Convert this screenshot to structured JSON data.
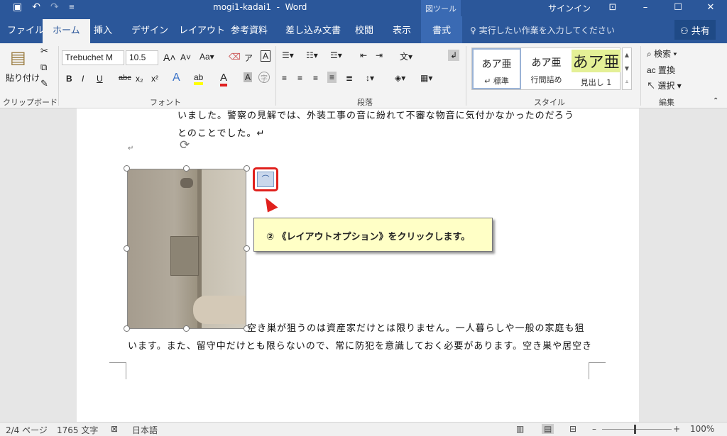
{
  "titlebar": {
    "title": "mogi1-kadai1  -  Word",
    "context_label": "図ツール",
    "signin": "サインイン",
    "qat": {
      "save_icon": "save-icon",
      "undo_icon": "undo-icon",
      "redo_icon": "redo-icon",
      "customize_icon": "customize-qat-icon"
    }
  },
  "tabs": [
    {
      "label": "ファイル"
    },
    {
      "label": "ホーム"
    },
    {
      "label": "挿入"
    },
    {
      "label": "デザイン"
    },
    {
      "label": "レイアウト"
    },
    {
      "label": "参考資料"
    },
    {
      "label": "差し込み文書"
    },
    {
      "label": "校閲"
    },
    {
      "label": "表示"
    },
    {
      "label": "書式"
    }
  ],
  "tellme": "実行したい作業を入力してください",
  "share": "共有",
  "ribbon": {
    "clipboard": {
      "paste": "貼り付け",
      "group": "クリップボード"
    },
    "font": {
      "font_name": "Trebuchet M",
      "font_size": "10.5",
      "group": "フォント"
    },
    "paragraph": {
      "group": "段落"
    },
    "styles": {
      "group": "スタイル",
      "items": [
        {
          "preview": "あア亜",
          "name": "↵ 標準"
        },
        {
          "preview": "あア亜",
          "name": "行間詰め"
        },
        {
          "preview": "あア亜",
          "name": "見出し 1"
        }
      ]
    },
    "editing": {
      "find": "検索",
      "replace": "置換",
      "select": "選択",
      "group": "編集"
    }
  },
  "document": {
    "lines": [
      "いました。警察の見解では、外装工事の音に紛れて不審な物音に気付かなかったのだろう",
      "とのことでした。↵",
      "空き巣が狙うのは資産家だけとは限りません。一人暮らしや一般の家庭も狙",
      "います。また、留守中だけとも限らないので、常に防犯を意識しておく必要があります。空き巣や居空き"
    ],
    "para_mark": "↵",
    "callout": "② 《レイアウトオプション》をクリックします。"
  },
  "status": {
    "page": "2/4 ページ",
    "words": "1765 文字",
    "language": "日本語",
    "zoom": "100%"
  }
}
